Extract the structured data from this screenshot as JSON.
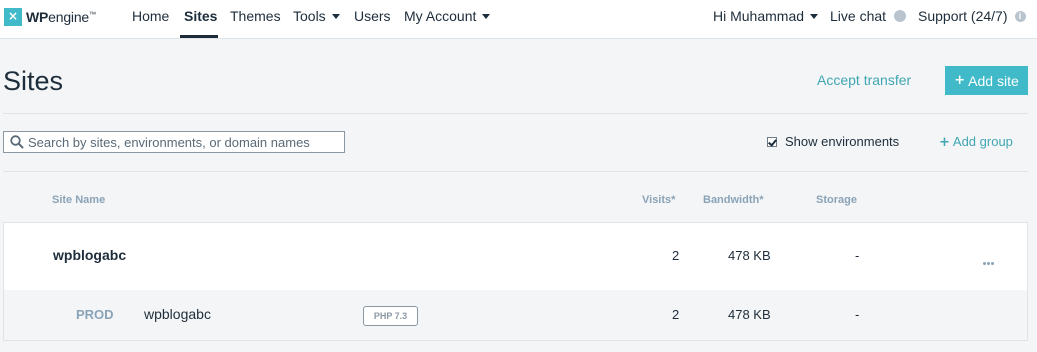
{
  "nav": {
    "logo_bold": "WP",
    "logo_light": "engine",
    "logo_mark": "™",
    "items": [
      {
        "label": "Home"
      },
      {
        "label": "Sites"
      },
      {
        "label": "Themes"
      },
      {
        "label": "Tools"
      },
      {
        "label": "Users"
      },
      {
        "label": "My Account"
      }
    ],
    "active": "Sites",
    "greeting": "Hi Muhammad",
    "live_chat": "Live chat",
    "support": "Support (24/7)"
  },
  "header": {
    "title": "Sites",
    "accept_transfer": "Accept transfer",
    "add_site": "Add site"
  },
  "filters": {
    "search_placeholder": "Search by sites, environments, or domain names",
    "search_value": "",
    "show_environments": "Show environments",
    "show_environments_checked": true,
    "add_group": "Add group"
  },
  "table": {
    "columns": [
      "Site Name",
      "Visits*",
      "Bandwidth*",
      "Storage"
    ],
    "sites": [
      {
        "name": "wpblogabc",
        "visits": "2",
        "bandwidth": "478 KB",
        "storage": "-",
        "environments": [
          {
            "type": "PROD",
            "name": "wpblogabc",
            "php": "PHP 7.3",
            "visits": "2",
            "bandwidth": "478 KB",
            "storage": "-"
          }
        ]
      }
    ]
  },
  "colors": {
    "accent": "#40bac8",
    "link": "#40a6b4",
    "text": "#1e2d3b",
    "muted": "#8ba3b7",
    "background": "#f3f5f6"
  },
  "icons": {
    "search": "search-icon",
    "more": "more-horizontal-icon",
    "info": "info-icon",
    "caret": "chevron-down-icon",
    "status_dot": "status-dot-icon"
  }
}
